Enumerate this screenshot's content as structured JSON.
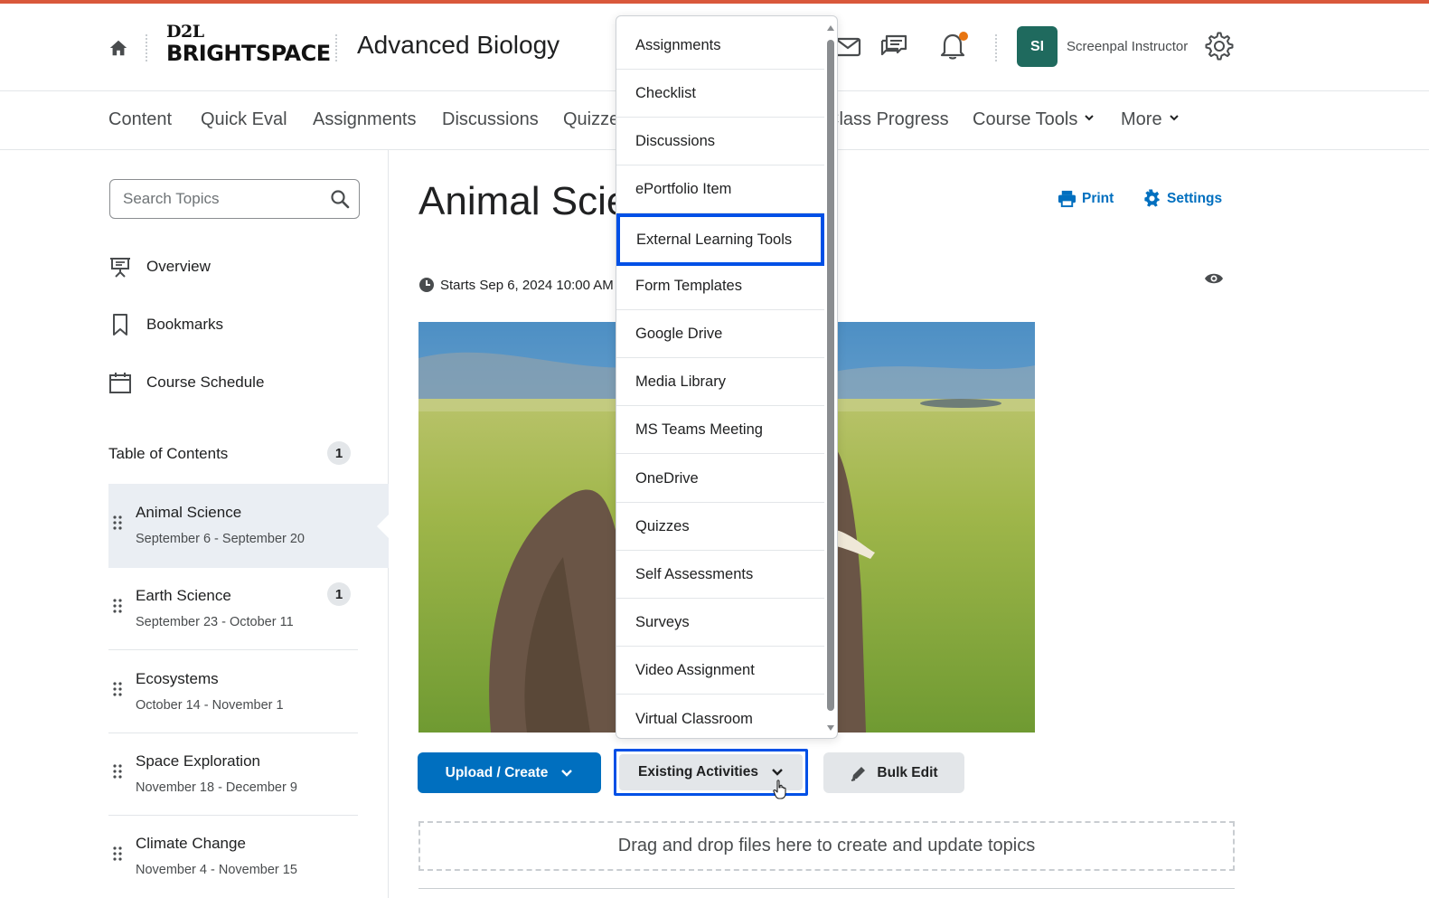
{
  "header": {
    "brand_top": "D2L",
    "brand_bottom": "BRIGHTSPACE",
    "course_title": "Advanced Biology",
    "user_initials": "SI",
    "user_name": "Screenpal Instructor",
    "notification_dot_color": "#e87511",
    "avatar_color": "#1f6a5e"
  },
  "nav": {
    "items": [
      "Content",
      "Quick Eval",
      "Assignments",
      "Discussions",
      "Quizzes",
      "Class Progress",
      "Course Tools",
      "More"
    ]
  },
  "sidebar": {
    "search_placeholder": "Search Topics",
    "links": [
      "Overview",
      "Bookmarks",
      "Course Schedule"
    ],
    "toc_label": "Table of Contents",
    "toc_count": "1",
    "units": [
      {
        "title": "Animal Science",
        "dates": "September 6 - September 20",
        "badge": ""
      },
      {
        "title": "Earth Science",
        "dates": "September 23 - October 11",
        "badge": "1"
      },
      {
        "title": "Ecosystems",
        "dates": "October 14 - November 1",
        "badge": ""
      },
      {
        "title": "Space Exploration",
        "dates": "November 18 - December 9",
        "badge": ""
      },
      {
        "title": "Climate Change",
        "dates": "November 4 - November 15",
        "badge": ""
      }
    ]
  },
  "main": {
    "title": "Animal Science",
    "print_label": "Print",
    "settings_label": "Settings",
    "starts_text": "Starts Sep 6, 2024 10:00 AM",
    "upload_label": "Upload / Create",
    "existing_label": "Existing Activities",
    "bulk_label": "Bulk Edit",
    "dropzone_text": "Drag and drop files here to create and update topics"
  },
  "dropdown": {
    "items": [
      "Assignments",
      "Checklist",
      "Discussions",
      "ePortfolio Item",
      "External Learning Tools",
      "Form Templates",
      "Google Drive",
      "Media Library",
      "MS Teams Meeting",
      "OneDrive",
      "Quizzes",
      "Self Assessments",
      "Surveys",
      "Video Assignment",
      "Virtual Classroom"
    ],
    "focused_item": "External Learning Tools"
  },
  "colors": {
    "accent_blue": "#006fbf",
    "focus_ring": "#0050e6",
    "top_line": "#d9583b"
  }
}
